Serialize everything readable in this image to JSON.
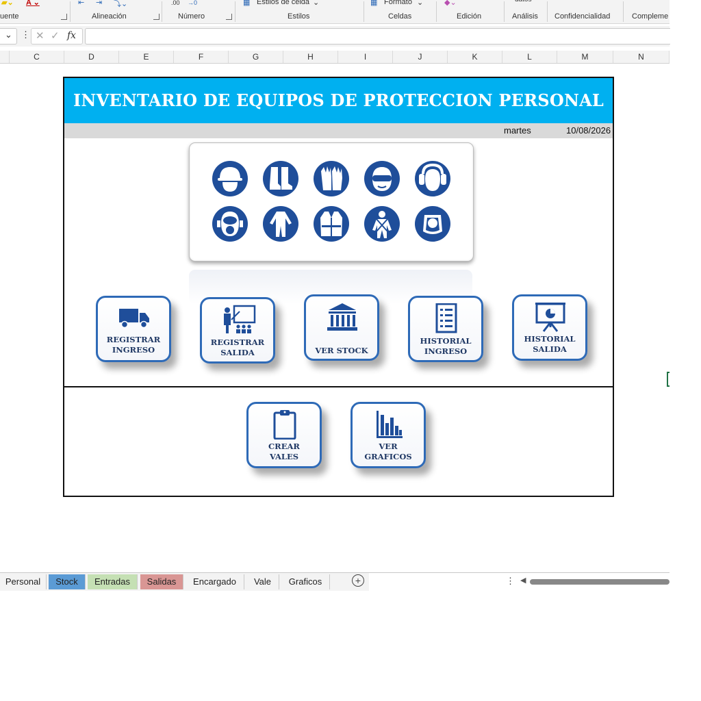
{
  "ribbon": {
    "groups": [
      {
        "label": "uente"
      },
      {
        "label": "Alineación"
      },
      {
        "label": "Número"
      },
      {
        "label": "Estilos"
      },
      {
        "label": "Celdas"
      },
      {
        "label": "Edición"
      },
      {
        "label": "Análisis"
      },
      {
        "label": "Confidencialidad"
      },
      {
        "label": "Compleme"
      }
    ],
    "styles_partial": "Estilos de celda",
    "format_partial": "Formato",
    "data_partial": "datos",
    "decimal_inc": ".00",
    "decimal_dec": "→0"
  },
  "formula_bar": {
    "fx": "fx",
    "value": ""
  },
  "columns": [
    "C",
    "D",
    "E",
    "F",
    "G",
    "H",
    "I",
    "J",
    "K",
    "L",
    "M",
    "N"
  ],
  "dashboard": {
    "title": "INVENTARIO DE EQUIPOS DE PROTECCION PERSONAL",
    "day": "martes",
    "date": "10/08/2026",
    "ppe_icons": [
      "helmet-icon",
      "boots-icon",
      "gloves-icon",
      "goggles-icon",
      "ear-protection-icon",
      "respirator-icon",
      "coverall-icon",
      "vest-icon",
      "harness-icon",
      "face-shield-icon"
    ],
    "buttons": [
      {
        "line1": "REGISTRAR",
        "line2": "INGRESO",
        "icon": "truck-icon"
      },
      {
        "line1": "REGISTRAR",
        "line2": "SALIDA",
        "icon": "presentation-icon"
      },
      {
        "line1": "VER STOCK",
        "line2": "",
        "icon": "bank-icon"
      },
      {
        "line1": "HISTORIAL",
        "line2": "INGRESO",
        "icon": "checklist-icon"
      },
      {
        "line1": "HISTORIAL",
        "line2": "SALIDA",
        "icon": "pie-board-icon"
      },
      {
        "line1": "CREAR",
        "line2": "VALES",
        "icon": "clipboard-icon"
      },
      {
        "line1": "VER",
        "line2": "GRAFICOS",
        "icon": "bar-chart-icon"
      }
    ]
  },
  "sheet_tabs": [
    {
      "label": "Personal",
      "color": "#f3f3f3"
    },
    {
      "label": "Stock",
      "color": "#5b9bd5"
    },
    {
      "label": "Entradas",
      "color": "#c5e0b4"
    },
    {
      "label": "Salidas",
      "color": "#d99694"
    },
    {
      "label": "Encargado",
      "color": "#f3f3f3"
    },
    {
      "label": "Vale",
      "color": "#f3f3f3"
    },
    {
      "label": "Graficos",
      "color": "#f3f3f3"
    }
  ],
  "colors": {
    "banner": "#00b0f0",
    "button_border": "#2e6ab7",
    "icon_blue": "#1f4e9a",
    "button_text": "#1f3864"
  }
}
